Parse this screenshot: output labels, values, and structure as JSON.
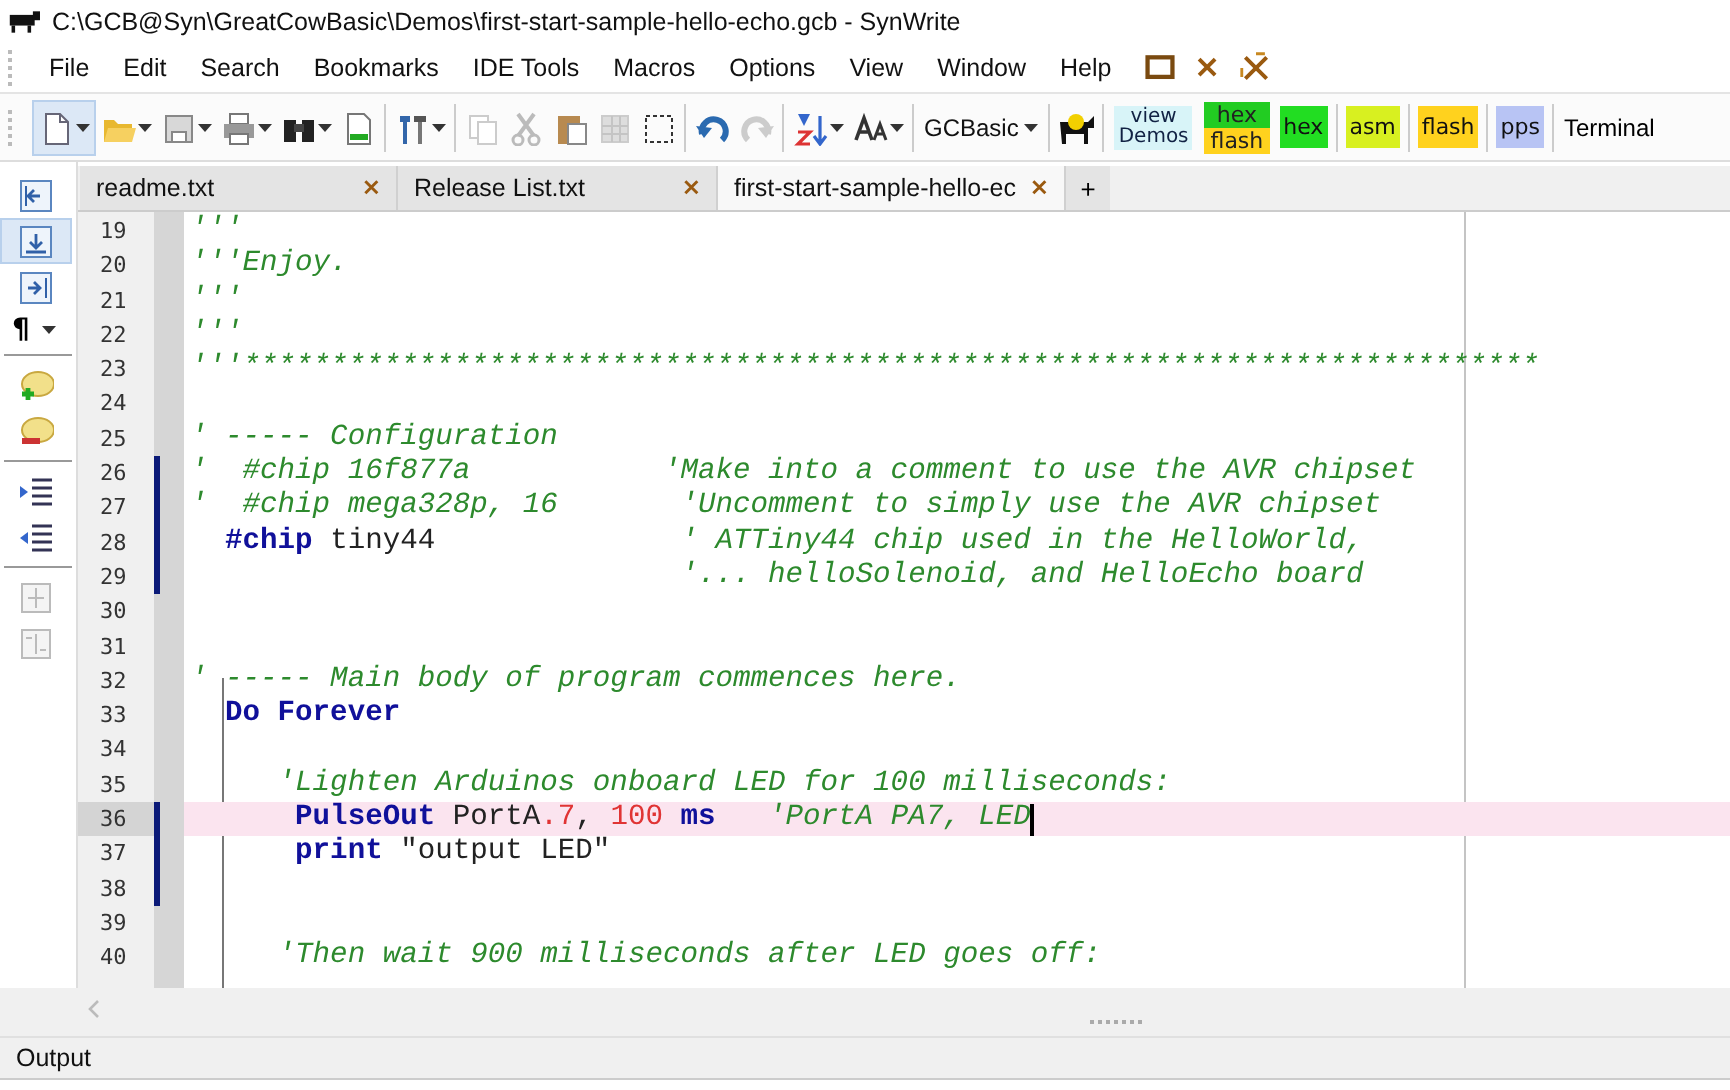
{
  "window": {
    "title": "C:\\GCB@Syn\\GreatCowBasic\\Demos\\first-start-sample-hello-echo.gcb - SynWrite"
  },
  "menu": [
    "File",
    "Edit",
    "Search",
    "Bookmarks",
    "IDE Tools",
    "Macros",
    "Options",
    "View",
    "Window",
    "Help"
  ],
  "toolbar_buttons": [
    {
      "kind": "dropdown",
      "label": "GCBasic"
    },
    {
      "kind": "stacked",
      "lines": [
        "view",
        "Demos"
      ],
      "color": "#d8f4f8"
    },
    {
      "kind": "split",
      "lines": [
        {
          "text": "hex",
          "color": "#22cc22"
        },
        {
          "text": "flash",
          "color": "#ffd21e"
        }
      ]
    },
    {
      "kind": "tag",
      "label": "hex",
      "color": "#22dd22"
    },
    {
      "kind": "tag",
      "label": "asm",
      "color": "#d8f020"
    },
    {
      "kind": "tag",
      "label": "flash",
      "color": "#ffd21e"
    },
    {
      "kind": "tag",
      "label": "pps",
      "color": "#b8c4f4"
    },
    {
      "kind": "plain",
      "label": "Terminal"
    }
  ],
  "side_toolbar": {
    "paragraph_button": "¶"
  },
  "tabs": [
    {
      "label": "readme.txt",
      "selected": false
    },
    {
      "label": "Release List.txt",
      "selected": false
    },
    {
      "label": "first-start-sample-hello-ec",
      "selected": true
    }
  ],
  "new_tab": "+",
  "editor": {
    "lines": [
      {
        "number": "19",
        "current": false,
        "modified": false,
        "tokens": [
          {
            "kind": "comment",
            "text": "'''"
          }
        ]
      },
      {
        "number": "20",
        "current": false,
        "modified": false,
        "tokens": [
          {
            "kind": "comment",
            "text": "'''Enjoy."
          }
        ]
      },
      {
        "number": "21",
        "current": false,
        "modified": false,
        "tokens": [
          {
            "kind": "comment",
            "text": "'''"
          }
        ]
      },
      {
        "number": "22",
        "current": false,
        "modified": false,
        "tokens": [
          {
            "kind": "comment",
            "text": "'''"
          }
        ]
      },
      {
        "number": "23",
        "current": false,
        "modified": false,
        "tokens": [
          {
            "kind": "comment",
            "text": "'''**************************************************************************"
          }
        ]
      },
      {
        "number": "24",
        "current": false,
        "modified": false
      },
      {
        "number": "25",
        "current": false,
        "modified": false,
        "tokens": [
          {
            "kind": "comment",
            "text": "' ----- Configuration"
          }
        ]
      },
      {
        "number": "26",
        "current": false,
        "modified": true,
        "tokens": [
          {
            "kind": "comment",
            "text": "'  #chip 16f877a           'Make into a comment to use the AVR chipset"
          }
        ]
      },
      {
        "number": "27",
        "current": false,
        "modified": true,
        "tokens": [
          {
            "kind": "comment",
            "text": "'  #chip mega328p, 16       'Uncomment to simply use the AVR chipset"
          }
        ]
      },
      {
        "number": "28",
        "current": false,
        "modified": true,
        "tokens": [
          {
            "kind": "keyword",
            "text": "  #chip"
          },
          {
            "kind": "plain",
            "text": " tiny44              "
          },
          {
            "kind": "comment",
            "text": "' ATTiny44 chip used in the HelloWorld,"
          }
        ]
      },
      {
        "number": "29",
        "current": false,
        "modified": true,
        "tokens": [
          {
            "kind": "comment",
            "text": "                            '... helloSolenoid, and HelloEcho board"
          }
        ]
      },
      {
        "number": "30",
        "current": false,
        "modified": false
      },
      {
        "number": "31",
        "current": false,
        "modified": false
      },
      {
        "number": "32",
        "current": false,
        "modified": false,
        "tokens": [
          {
            "kind": "comment",
            "text": "' ----- Main body of program commences here."
          }
        ]
      },
      {
        "number": "33",
        "current": false,
        "modified": false,
        "tokens": [
          {
            "kind": "keyword",
            "text": "  Do Forever"
          }
        ]
      },
      {
        "number": "34",
        "current": false,
        "modified": false
      },
      {
        "number": "35",
        "current": false,
        "modified": false,
        "tokens": [
          {
            "kind": "comment",
            "text": "     'Lighten Arduinos onboard LED for 100 milliseconds:"
          }
        ]
      },
      {
        "number": "36",
        "current": true,
        "modified": true,
        "tokens": [
          {
            "kind": "keyword",
            "text": "      PulseOut"
          },
          {
            "kind": "plain",
            "text": " PortA"
          },
          {
            "kind": "number",
            "text": ".7"
          },
          {
            "kind": "plain",
            "text": ", "
          },
          {
            "kind": "number",
            "text": "100"
          },
          {
            "kind": "keyword",
            "text": " ms   "
          },
          {
            "kind": "comment",
            "text": "'PortA PA7, LED"
          }
        ]
      },
      {
        "number": "37",
        "current": false,
        "modified": true,
        "tokens": [
          {
            "kind": "keyword",
            "text": "      print"
          },
          {
            "kind": "plain",
            "text": " \"output LED\""
          }
        ]
      },
      {
        "number": "38",
        "current": false,
        "modified": true
      },
      {
        "number": "39",
        "current": false,
        "modified": false
      },
      {
        "number": "40",
        "current": false,
        "modified": false,
        "tokens": [
          {
            "kind": "comment",
            "text": "     'Then wait 900 milliseconds after LED goes off:"
          }
        ]
      }
    ]
  },
  "output": {
    "title": "Output"
  }
}
